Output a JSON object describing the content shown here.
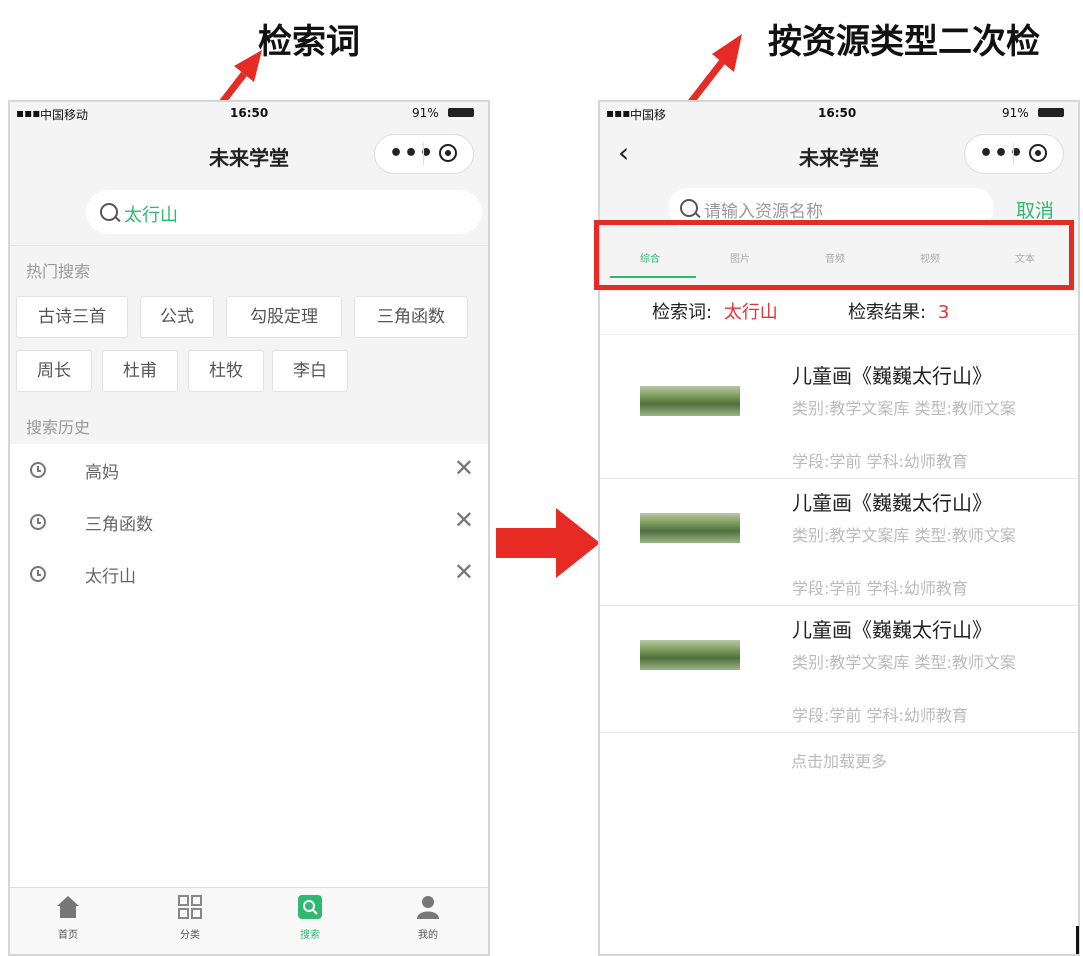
{
  "callouts": {
    "left": "检索词",
    "right": "按资源类型二次检"
  },
  "left_phone": {
    "status": {
      "carrier": "中国移动",
      "time": "16:50",
      "battery": "91%"
    },
    "title": "未来学堂",
    "search_value": "太行山",
    "hot_label": "热门搜索",
    "hot_items": [
      "古诗三首",
      "公式",
      "勾股定理",
      "三角函数",
      "周长",
      "杜甫",
      "杜牧",
      "李白"
    ],
    "history_label": "搜索历史",
    "history": [
      "高妈",
      "三角函数",
      "太行山"
    ],
    "tabbar": [
      {
        "label": "首页",
        "icon": "home-icon"
      },
      {
        "label": "分类",
        "icon": "grid-icon"
      },
      {
        "label": "搜索",
        "icon": "search-icon"
      },
      {
        "label": "我的",
        "icon": "user-icon"
      }
    ]
  },
  "right_phone": {
    "status": {
      "carrier": "中国移",
      "time": "16:50",
      "battery": "91%"
    },
    "title": "未来学堂",
    "search_placeholder": "请输入资源名称",
    "cancel": "取消",
    "tabs": [
      "综合",
      "图片",
      "音频",
      "视频",
      "文本"
    ],
    "keyword_label": "检索词:",
    "keyword_value": "太行山",
    "result_label": "检索结果:",
    "result_count": "3",
    "results": [
      {
        "title": "儿童画《巍巍太行山》",
        "meta": "类别:教学文案库 类型:教师文案",
        "stage": "学段:学前 学科:幼师教育"
      },
      {
        "title": "儿童画《巍巍太行山》",
        "meta": "类别:教学文案库 类型:教师文案",
        "stage": "学段:学前 学科:幼师教育"
      },
      {
        "title": "儿童画《巍巍太行山》",
        "meta": "类别:教学文案库 类型:教师文案",
        "stage": "学段:学前 学科:幼师教育"
      }
    ],
    "load_more": "点击加载更多"
  },
  "colors": {
    "arrow_red": "#e62a24",
    "accent_green": "#2eb872",
    "highlight_red": "#e8323a"
  }
}
